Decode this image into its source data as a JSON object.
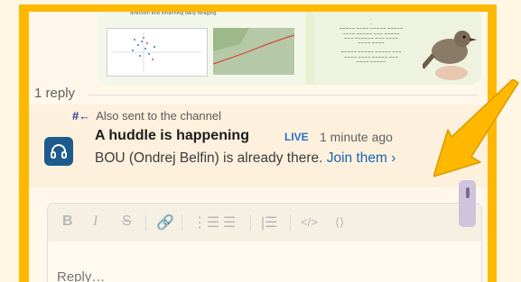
{
  "thread": {
    "reply_count": "1 reply"
  },
  "message": {
    "also_sent": "Also sent to the channel",
    "title": "A huddle is happening",
    "live_badge": "LIVE",
    "timestamp": "1 minute ago",
    "body_text": "BOU (Ondrej Belfin) is already there.",
    "join_link": "Join them",
    "join_chevron": "›"
  },
  "composer": {
    "placeholder": "Reply…",
    "tools": [
      "bold-icon",
      "italic-icon",
      "strikethrough-icon",
      "link-icon",
      "numbered-list-icon",
      "bulleted-list-icon",
      "blockquote-icon",
      "code-icon",
      "code-block-icon"
    ]
  },
  "colors": {
    "highlight_frame": "#ffb800",
    "link": "#1a66b5",
    "avatar_bg": "#1d5b8c"
  }
}
